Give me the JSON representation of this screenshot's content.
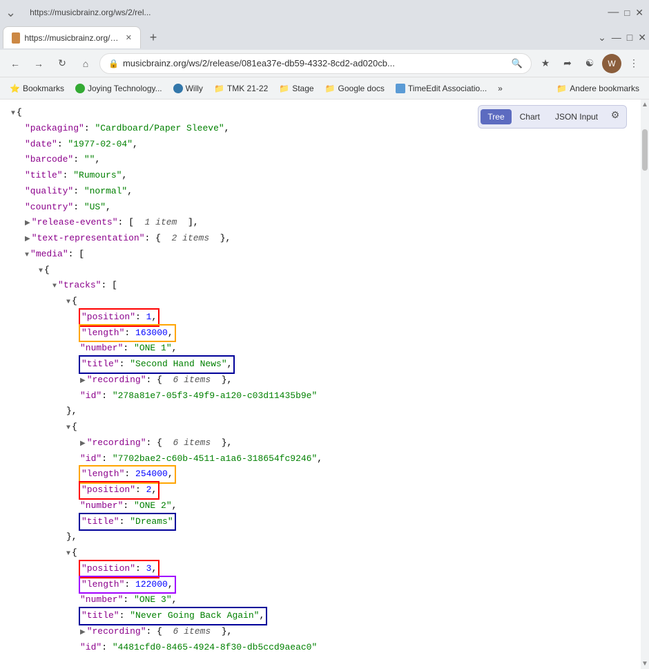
{
  "browser": {
    "title": "https://musicbrainz.org/ws/2/rel...",
    "tab_label": "https://musicbrainz.org/ws/2/rel...",
    "address": "musicbrainz.org/ws/2/release/081ea37e-db59-4332-8cd2-ad020cb...",
    "favicon": "🎵"
  },
  "bookmarks": [
    {
      "label": "Bookmarks",
      "icon": "⭐"
    },
    {
      "label": "Joying Technology...",
      "icon": "🌐"
    },
    {
      "label": "Willy",
      "icon": "🌐"
    },
    {
      "label": "TMK 21-22",
      "icon": "📁"
    },
    {
      "label": "Stage",
      "icon": "📁"
    },
    {
      "label": "Google docs",
      "icon": "📁"
    },
    {
      "label": "TimeEdit Associatio...",
      "icon": "🟦"
    },
    {
      "label": "»",
      "icon": ""
    },
    {
      "label": "Andere bookmarks",
      "icon": "📁"
    }
  ],
  "toolbar": {
    "tree_label": "Tree",
    "chart_label": "Chart",
    "json_input_label": "JSON Input",
    "active": "Tree"
  },
  "json_data": {
    "packaging": "Cardboard/Paper Sleeve",
    "date": "1977-02-04",
    "barcode": "",
    "title": "Rumours",
    "quality": "normal",
    "country": "US",
    "release_events_summary": "1 item",
    "text_representation_summary": "2 items",
    "tracks": [
      {
        "position": "1",
        "length": "163000",
        "number": "ONE 1",
        "title": "Second Hand News",
        "recording_summary": "6 items",
        "recording_id": "278a81e7-05f3-49f9-a120-c03d11435b9e"
      },
      {
        "recording_summary": "6 items",
        "recording_id": "7702bae2-c60b-4511-a1a6-318654fc9246",
        "length": "254000",
        "position": "2",
        "number": "ONE 2",
        "title": "Dreams"
      },
      {
        "position": "3",
        "length": "122000",
        "number": "ONE 3",
        "title": "Never Going Back Again",
        "recording_summary": "6 items",
        "recording_id": "4481cfd0-8465-4924-8f30-db5ccd9aeac0"
      }
    ]
  }
}
